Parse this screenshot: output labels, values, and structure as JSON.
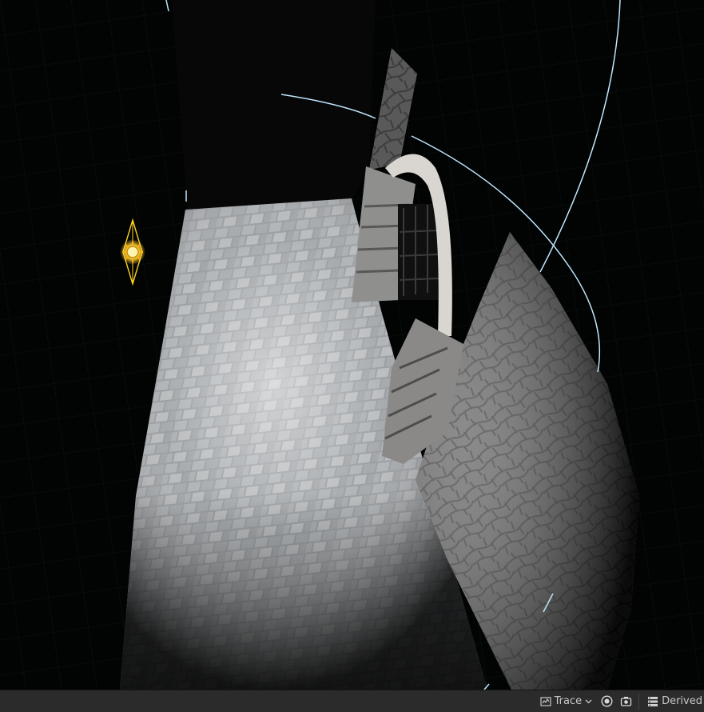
{
  "viewport": {
    "scene": "dungeon-corridor-with-spotlight",
    "light_actor": "point-light-icon"
  },
  "statusbar": {
    "trace_label": "Trace",
    "trace_icon": "trace-icon",
    "derived_label": "Derived",
    "icons": [
      "record-icon",
      "camera-icon",
      "derived-data-icon",
      "chevron-down-icon"
    ]
  },
  "colors": {
    "statusbar_bg": "#2b2b2b",
    "statusbar_text": "#c8c8c8",
    "light_gizmo": "#ffd21f",
    "attenuation_line": "#bfe8ff"
  }
}
